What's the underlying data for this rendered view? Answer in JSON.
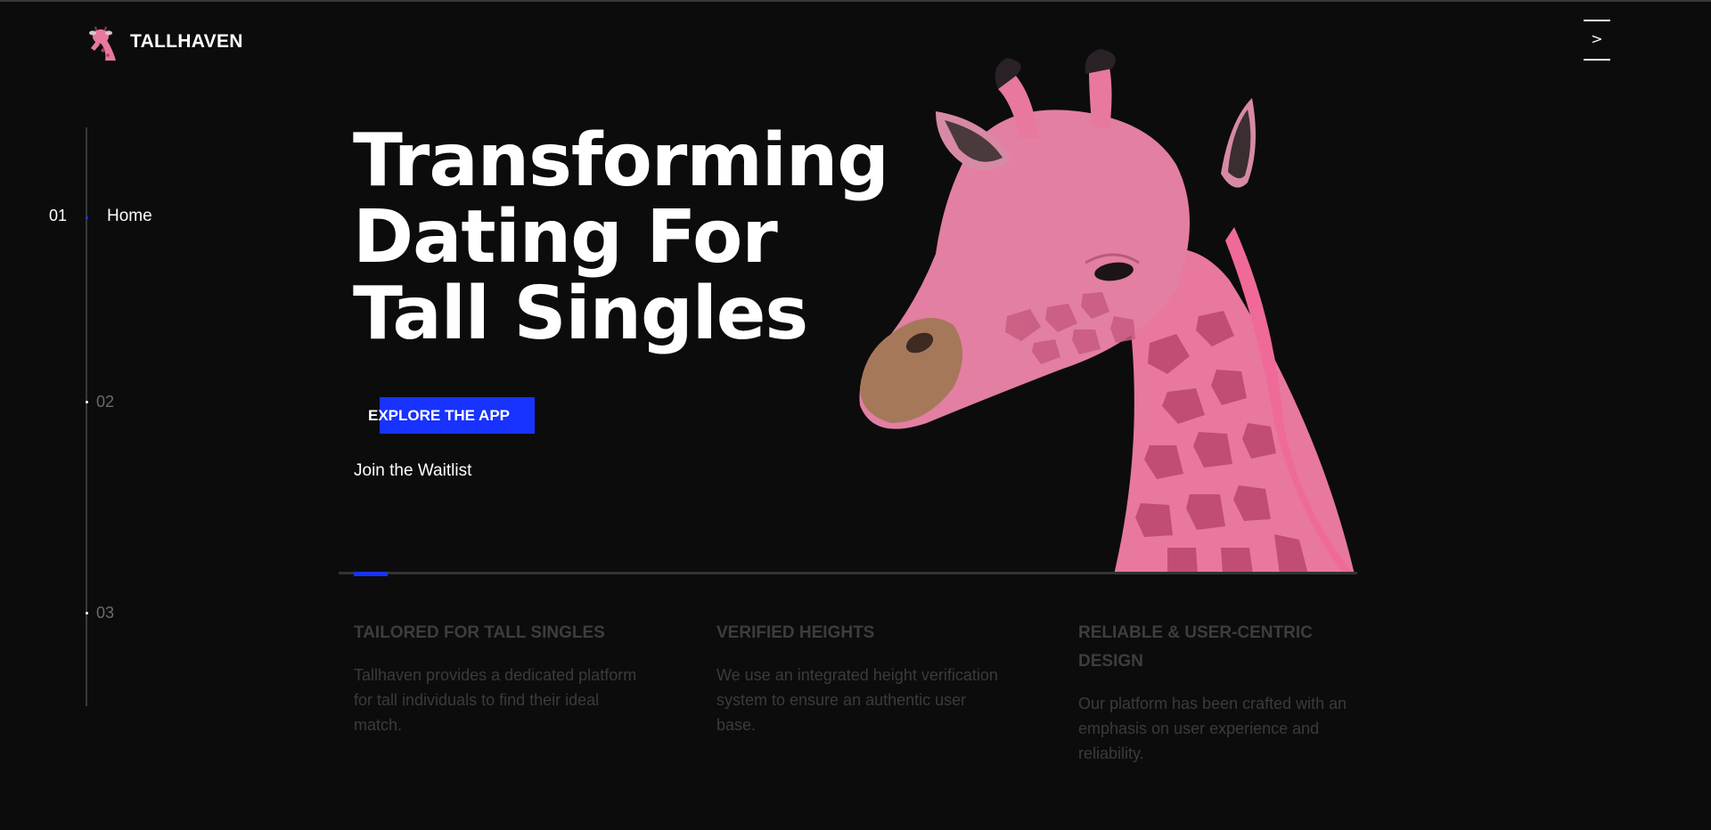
{
  "header": {
    "brand_name": "TALLHAVEN",
    "logo_icon": "giraffe-logo-icon",
    "menu_chevron": ">"
  },
  "side_nav": {
    "items": [
      {
        "number": "01",
        "label": "Home",
        "active": true
      },
      {
        "number": "02",
        "label": "",
        "active": false
      },
      {
        "number": "03",
        "label": "",
        "active": false
      }
    ]
  },
  "hero": {
    "title_lines": [
      "Transforming",
      "Dating For",
      "Tall Singles"
    ],
    "cta_label": "EXPLORE THE APP",
    "secondary_link": "Join the Waitlist",
    "image_icon": "pink-giraffe-illustration"
  },
  "progress": {
    "current": 1,
    "total": 3
  },
  "features": [
    {
      "title": "TAILORED FOR TALL SINGLES",
      "body": "Tallhaven provides a dedicated platform for tall individuals to find their ideal match."
    },
    {
      "title": "VERIFIED HEIGHTS",
      "body": "We use an integrated height verification system to ensure an authentic user base."
    },
    {
      "title": "RELIABLE & USER-CENTRIC DESIGN",
      "body": "Our platform has been crafted with an emphasis on user experience and reliability."
    }
  ],
  "colors": {
    "background": "#0c0c0d",
    "accent": "#1832ff",
    "giraffe_pink": "#e8789e",
    "muted_text": "#3b3b3e"
  }
}
